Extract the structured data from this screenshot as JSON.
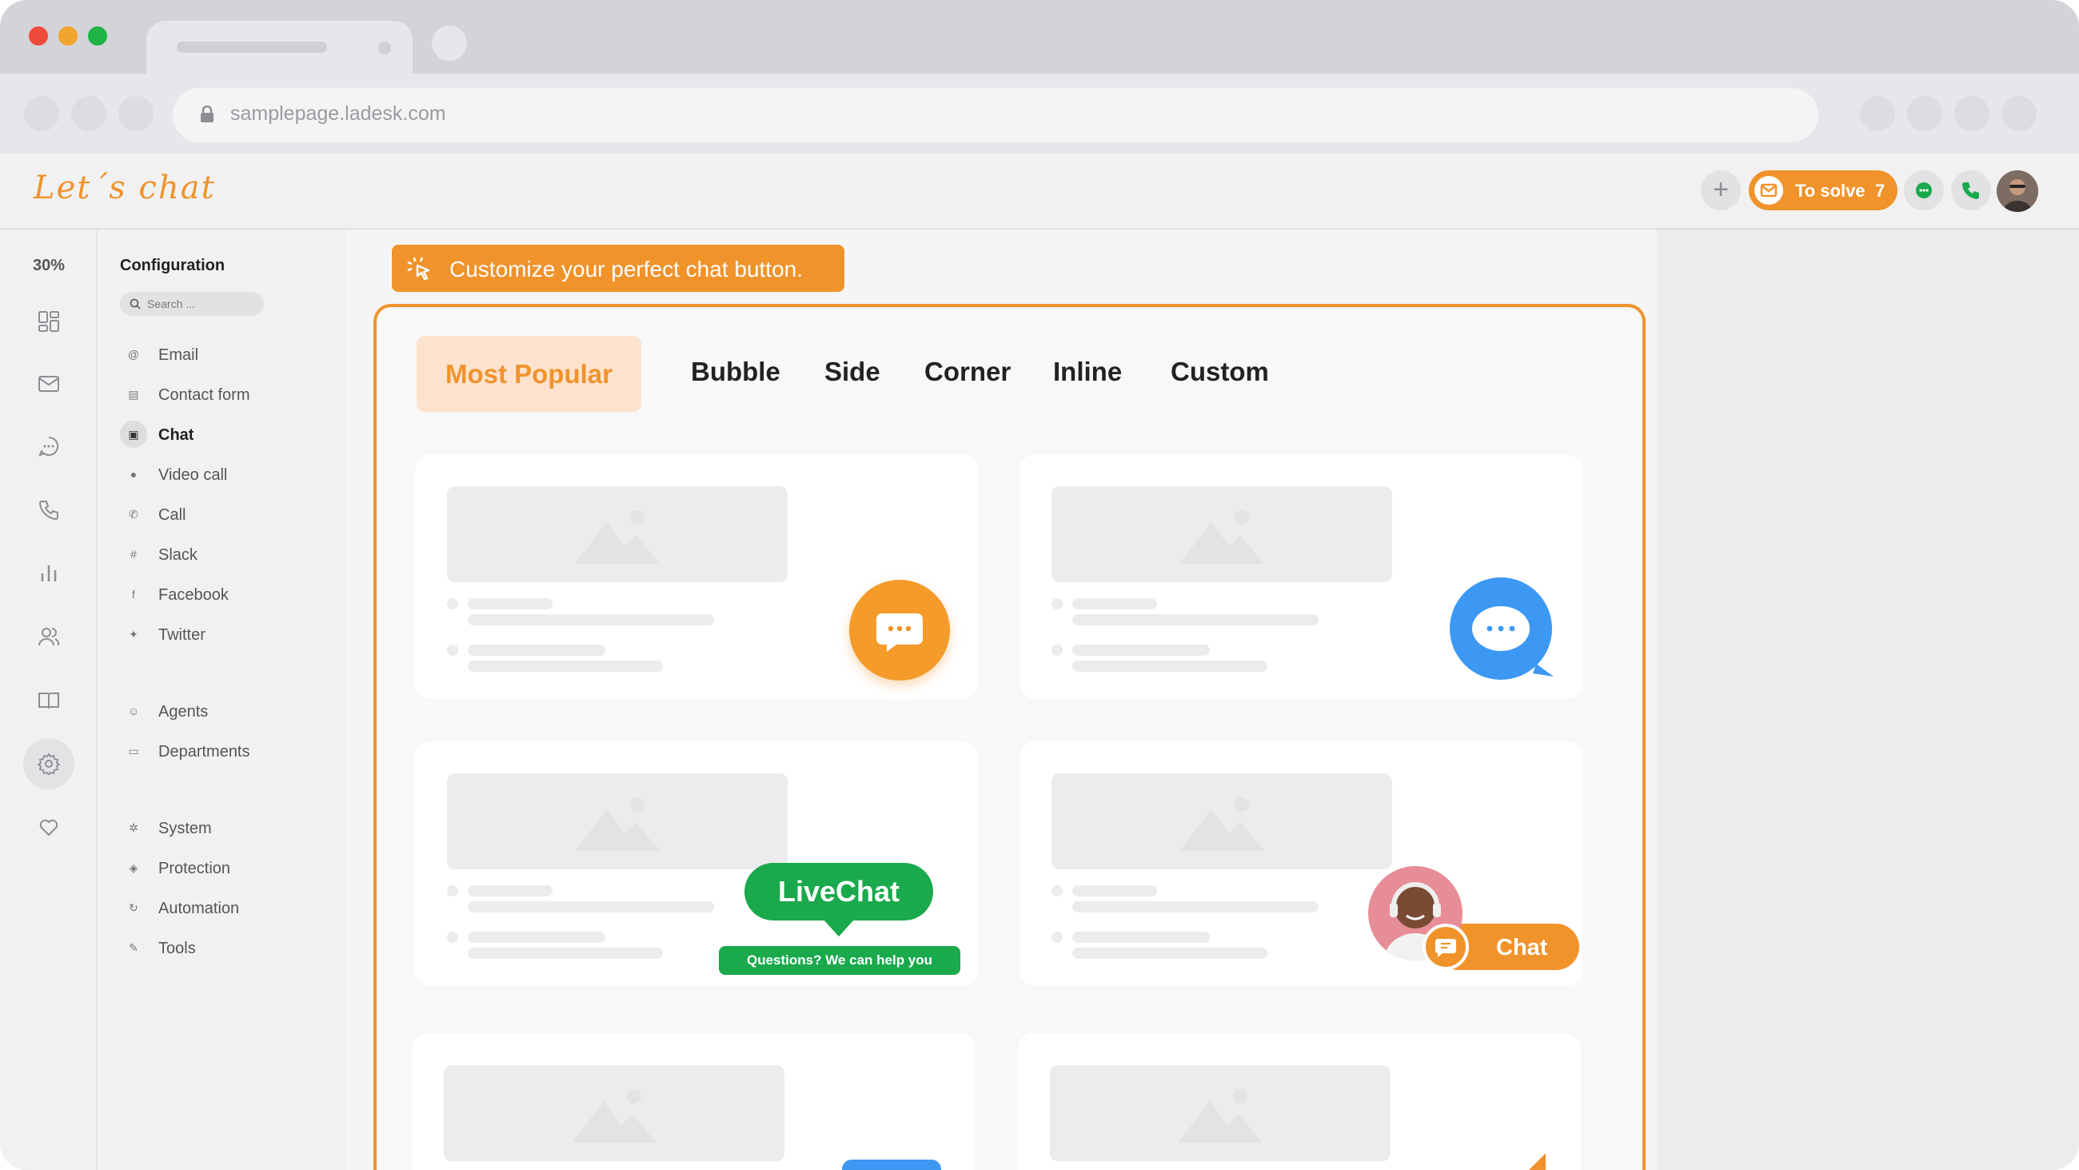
{
  "browser": {
    "url": "samplepage.ladesk.com"
  },
  "header": {
    "logo": "Let´s chat",
    "to_solve_label": "To solve",
    "to_solve_count": "7"
  },
  "rail": {
    "progress": "30%"
  },
  "config": {
    "title": "Configuration",
    "search_placeholder": "Search ...",
    "items": [
      {
        "label": "Email",
        "icon": "at-icon"
      },
      {
        "label": "Contact form",
        "icon": "form-icon"
      },
      {
        "label": "Chat",
        "icon": "chat-icon",
        "active": true
      },
      {
        "label": "Video call",
        "icon": "video-icon"
      },
      {
        "label": "Call",
        "icon": "phone-icon"
      },
      {
        "label": "Slack",
        "icon": "slack-icon"
      },
      {
        "label": "Facebook",
        "icon": "facebook-icon"
      },
      {
        "label": "Twitter",
        "icon": "twitter-icon"
      },
      {
        "label": "Agents",
        "icon": "agent-icon"
      },
      {
        "label": "Departments",
        "icon": "folder-icon"
      },
      {
        "label": "System",
        "icon": "gear-icon"
      },
      {
        "label": "Protection",
        "icon": "shield-icon"
      },
      {
        "label": "Automation",
        "icon": "refresh-icon"
      },
      {
        "label": "Tools",
        "icon": "wrench-icon"
      }
    ]
  },
  "main": {
    "banner": "Customize your perfect chat button.",
    "tabs": [
      "Most Popular",
      "Bubble",
      "Side",
      "Corner",
      "Inline",
      "Custom"
    ],
    "active_tab": "Most Popular",
    "livechat_label": "LiveChat",
    "livechat_sub": "Questions? We can help you",
    "chat_label": "Chat"
  },
  "colors": {
    "accent": "#f0932b",
    "blue": "#3d98f4",
    "green": "#1aa94c"
  }
}
